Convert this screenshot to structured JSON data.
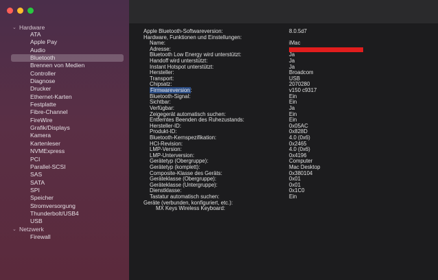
{
  "sidebar": {
    "hardware_group": "Hardware",
    "network_group": "Netzwerk",
    "items": [
      "ATA",
      "Apple Pay",
      "Audio",
      "Bluetooth",
      "Brennen von Medien",
      "Controller",
      "Diagnose",
      "Drucker",
      "Ethernet-Karten",
      "Festplatte",
      "Fibre-Channel",
      "FireWire",
      "Grafik/Displays",
      "Kamera",
      "Kartenleser",
      "NVMExpress",
      "PCI",
      "Parallel-SCSI",
      "SAS",
      "SATA",
      "SPI",
      "Speicher",
      "Stromversorgung",
      "Thunderbolt/USB4",
      "USB"
    ],
    "network_items": [
      "Firewall"
    ],
    "selected": "Bluetooth"
  },
  "content": {
    "rows": [
      {
        "key": "Apple Bluetooth-Softwareversion:",
        "value": "8.0.5d7",
        "indent": 0
      },
      {
        "key": "Hardware, Funktionen und Einstellungen:",
        "value": "",
        "indent": 0
      },
      {
        "key": "Name:",
        "value": "iMac",
        "indent": 1
      },
      {
        "key": "Adresse:",
        "value": "",
        "indent": 1,
        "redacted": true
      },
      {
        "key": "Bluetooth Low Energy wird unterstützt:",
        "value": "Ja",
        "indent": 1
      },
      {
        "key": "Handoff wird unterstützt:",
        "value": "Ja",
        "indent": 1
      },
      {
        "key": "Instant Hotspot unterstützt:",
        "value": "Ja",
        "indent": 1
      },
      {
        "key": "Hersteller:",
        "value": "Broadcom",
        "indent": 1
      },
      {
        "key": "Transport:",
        "value": "USB",
        "indent": 1
      },
      {
        "key": "Chipsatz:",
        "value": "2070280",
        "indent": 1
      },
      {
        "key": "Firmwareversion:",
        "value": "v150 c9317",
        "indent": 1,
        "highlight": true
      },
      {
        "key": "Bluetooth-Signal:",
        "value": "Ein",
        "indent": 1
      },
      {
        "key": "Sichtbar:",
        "value": "Ein",
        "indent": 1
      },
      {
        "key": "Verfügbar:",
        "value": "Ja",
        "indent": 1
      },
      {
        "key": "Zeigegerät automatisch suchen:",
        "value": "Ein",
        "indent": 1
      },
      {
        "key": "Entferntes Beenden des Ruhezustands:",
        "value": "Ein",
        "indent": 1
      },
      {
        "key": "Hersteller-ID:",
        "value": "0x05AC",
        "indent": 1
      },
      {
        "key": "Produkt-ID:",
        "value": "0x828D",
        "indent": 1
      },
      {
        "key": "Bluetooth-Kernspezifikation:",
        "value": "4.0 (0x6)",
        "indent": 1
      },
      {
        "key": "HCI-Revision:",
        "value": "0x2465",
        "indent": 1
      },
      {
        "key": "LMP-Version:",
        "value": "4.0 (0x6)",
        "indent": 1
      },
      {
        "key": "LMP-Unterversion:",
        "value": "0x4196",
        "indent": 1
      },
      {
        "key": "Gerätetyp (Obergruppe):",
        "value": "Computer",
        "indent": 1
      },
      {
        "key": "Gerätetyp (komplett):",
        "value": "Mac Desktop",
        "indent": 1
      },
      {
        "key": "Composite-Klasse des Geräts:",
        "value": "0x380104",
        "indent": 1
      },
      {
        "key": "Geräteklasse (Obergruppe):",
        "value": "0x01",
        "indent": 1
      },
      {
        "key": "Geräteklasse (Untergruppe):",
        "value": "0x01",
        "indent": 1
      },
      {
        "key": "Dienstklasse:",
        "value": "0x1C0",
        "indent": 1
      },
      {
        "key": "Tastatur automatisch suchen:",
        "value": "Ein",
        "indent": 1
      },
      {
        "key": "Geräte (verbunden, konfiguriert, etc.):",
        "value": "",
        "indent": 0
      },
      {
        "key": "MX Keys Wireless Keyboard:",
        "value": "",
        "indent": 2
      }
    ]
  }
}
